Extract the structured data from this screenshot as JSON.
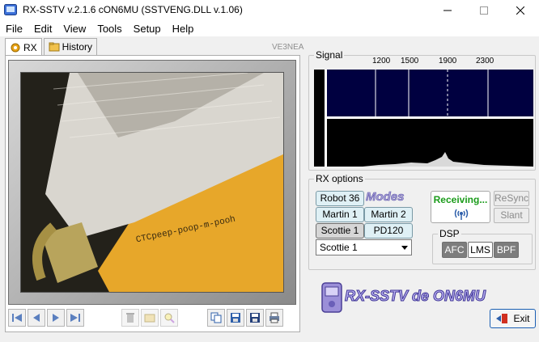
{
  "window": {
    "title": "RX-SSTV v.2.1.6 cON6MU (SSTVENG.DLL v.1.06)",
    "controls": {
      "minimize": "—",
      "maximize": "☐",
      "close": "✕"
    }
  },
  "menu": [
    "File",
    "Edit",
    "View",
    "Tools",
    "Setup",
    "Help"
  ],
  "tabs": {
    "rx": "RX",
    "history": "History"
  },
  "callsign": "VE3NEA",
  "signal": {
    "label": "Signal",
    "freq_ticks": [
      "1200",
      "1500",
      "1900",
      "2300"
    ]
  },
  "rx_options": {
    "label": "RX options",
    "modes_logo": "Modes",
    "modes": [
      {
        "label": "Robot 36",
        "selected": false
      },
      {
        "label": "Martin 1",
        "selected": false
      },
      {
        "label": "Martin 2",
        "selected": false
      },
      {
        "label": "Scottie 1",
        "selected": true
      },
      {
        "label": "PD120",
        "selected": false
      }
    ],
    "select_value": "Scottie 1",
    "status": "Receiving...",
    "resync": "ReSync",
    "slant": "Slant"
  },
  "dsp": {
    "label": "DSP",
    "afc": "AFC",
    "lms": "LMS",
    "bpf": "BPF"
  },
  "logo_text": "RX-SSTV de ON6MU",
  "exit": "Exit",
  "colors": {
    "accent": "#1a5fb4",
    "status": "#1a9b1a",
    "waterfall": "#000040"
  }
}
